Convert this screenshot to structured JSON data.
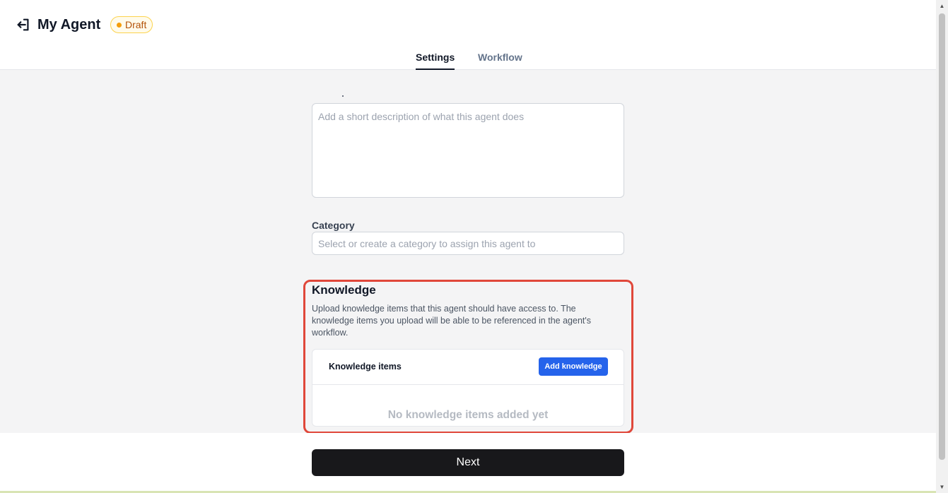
{
  "header": {
    "back_icon": "log-out-arrow-left-icon",
    "title": "My Agent",
    "status_badge": "Draft",
    "status_color": "#f59e0b"
  },
  "tabs": [
    {
      "label": "Settings",
      "active": true
    },
    {
      "label": "Workflow",
      "active": false
    }
  ],
  "form": {
    "description": {
      "placeholder": "Add a short description of what this agent does",
      "value": ""
    },
    "category": {
      "label": "Category",
      "placeholder": "Select or create a category to assign this agent to",
      "value": ""
    }
  },
  "knowledge": {
    "title": "Knowledge",
    "description": "Upload knowledge items that this agent should have access to. The knowledge items you upload will be able to be referenced in the agent's workflow.",
    "card_title": "Knowledge items",
    "add_button": "Add knowledge",
    "empty_text": "No knowledge items added yet",
    "accent_color": "#2563eb",
    "highlight_color": "#e0473a"
  },
  "footer": {
    "next_button": "Next"
  },
  "scrollbar": {
    "up_icon": "scroll-up-arrow-icon",
    "down_icon": "scroll-down-arrow-icon"
  }
}
